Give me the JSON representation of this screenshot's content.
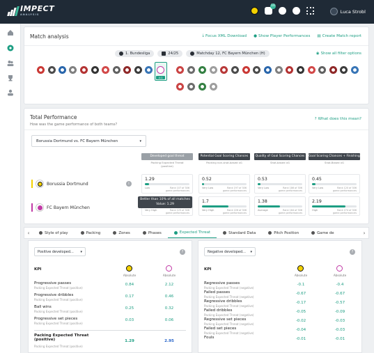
{
  "app": {
    "brand": "IMPECT",
    "brand_sub": "ANALYSIS",
    "user_name": "Luca Strobl",
    "notification_count": "10"
  },
  "match_analysis": {
    "title": "Match analysis",
    "links": [
      "Focus XML Download",
      "Show Player Performances",
      "Create Match report"
    ],
    "filters": [
      "1. Bundesliga",
      "24/25",
      "Matchday 12, FC Bayern München (H)"
    ],
    "show_filters": "Show all filter options",
    "selected_score": "4:1"
  },
  "total_performance": {
    "title": "Total Performance",
    "subtitle": "How was the game performance of both teams?",
    "help_link": "What does this mean?",
    "match_select": "Borussia Dortmund vs. FC Bayern München",
    "columns": [
      {
        "head": "Developed goal threat",
        "sub1": "Packing Expected Threat",
        "sub2": "(positive)",
        "light": true
      },
      {
        "head": "Potential Goal Scoring Chances",
        "sub1": "Packing non-shot-based xG",
        "sub2": "",
        "light": false
      },
      {
        "head": "Quality of Goal Scoring Chances",
        "sub1": "Shot-based xG",
        "sub2": "",
        "light": false
      },
      {
        "head": "Goal Scoring Chances + Finishing Quality",
        "sub1": "Shot-Based xG",
        "sub2": "",
        "light": false
      }
    ],
    "teams": [
      {
        "name": "Borussia Dortmund",
        "color": "#f3d100",
        "cells": [
          {
            "value": "1.29",
            "label": "Low",
            "rank": "Rank 107 of 306 game performances",
            "fill": 0.1
          },
          {
            "value": "0.52",
            "label": "Very Low",
            "rank": "Rank 197 of 306 game performances",
            "fill": 0.05
          },
          {
            "value": "0.53",
            "label": "Very Low",
            "rank": "Rank 186 of 306 game performances",
            "fill": 0.06
          },
          {
            "value": "0.45",
            "label": "Very Low",
            "rank": "Rank 120 of 306 game performances",
            "fill": 0.08
          }
        ]
      },
      {
        "name": "FC Bayern München",
        "color": "#c13aa6",
        "cells": [
          {
            "value": "",
            "label": "Very High",
            "rank": "Rank 125 of 306 game performances",
            "fill": 0.4
          },
          {
            "value": "1.7",
            "label": "Very High",
            "rank": "Rank 226 of 306 game performances",
            "fill": 0.6
          },
          {
            "value": "1.38",
            "label": "Average",
            "rank": "Rank 184 of 306 game performances",
            "fill": 0.5
          },
          {
            "value": "2.19",
            "label": "High",
            "rank": "Rank 274 of 306 game performances",
            "fill": 0.75
          }
        ]
      }
    ],
    "tooltip_line1": "Better than 10% of all matches",
    "tooltip_line2": "Value: 1.29"
  },
  "tabs": [
    "Style of play",
    "Packing",
    "Zones",
    "Phases",
    "Expected Threat",
    "Standard Data",
    "Pitch Position",
    "Game de"
  ],
  "active_tab": 4,
  "left_panel": {
    "select": "Positive developed...",
    "kpi_header": "KPI",
    "abs_label": "Absolute",
    "rows": [
      {
        "name": "Progressive passes",
        "sub": "Packing Expected Threat (positive)",
        "v1": "0.84",
        "v2": "2.12"
      },
      {
        "name": "Progressive dribbles",
        "sub": "Packing Expected Threat (positive)",
        "v1": "0.17",
        "v2": "0.46"
      },
      {
        "name": "Ball wins",
        "sub": "Packing Expected Threat (positive)",
        "v1": "0.25",
        "v2": "0.32"
      },
      {
        "name": "Progressive set pieces",
        "sub": "Packing Expected Threat (positive)",
        "v1": "0.03",
        "v2": "0.06"
      }
    ],
    "total": {
      "name1": "Packing Expected Threat",
      "name2": "(positive)",
      "sub": "Packing Expected Threat (positive)",
      "v1": "1.29",
      "v2": "2.95"
    }
  },
  "right_panel": {
    "select": "Negative developed...",
    "kpi_header": "KPI",
    "abs_label": "Absolute",
    "rows": [
      {
        "name": "Regressive passes",
        "sub": "Packing Expected Threat (negative)",
        "v1": "-0.1",
        "v2": "-0.4"
      },
      {
        "name": "Failed passes",
        "sub": "Packing Expected Threat (negative)",
        "v1": "-0.67",
        "v2": "-0.67"
      },
      {
        "name": "Regressive dribbles",
        "sub": "Packing Expected Threat (negative)",
        "v1": "-0.17",
        "v2": "-0.57"
      },
      {
        "name": "Failed dribbles",
        "sub": "Packing Expected Threat (negative)",
        "v1": "-0.05",
        "v2": "-0.09"
      },
      {
        "name": "Regressive set pieces",
        "sub": "Packing Expected Threat (negative)",
        "v1": "-0.02",
        "v2": "-0.03"
      },
      {
        "name": "Failed set pieces",
        "sub": "Packing Expected Threat (negative)",
        "v1": "-0.04",
        "v2": "-0.03"
      },
      {
        "name": "Fouls",
        "sub": "",
        "v1": "-0.01",
        "v2": "-0.01"
      }
    ]
  },
  "colors": {
    "accent": "#1d9e83",
    "dortmund": "#f3d100",
    "bayern": "#c13aa6",
    "topbar": "#1f2a36"
  }
}
